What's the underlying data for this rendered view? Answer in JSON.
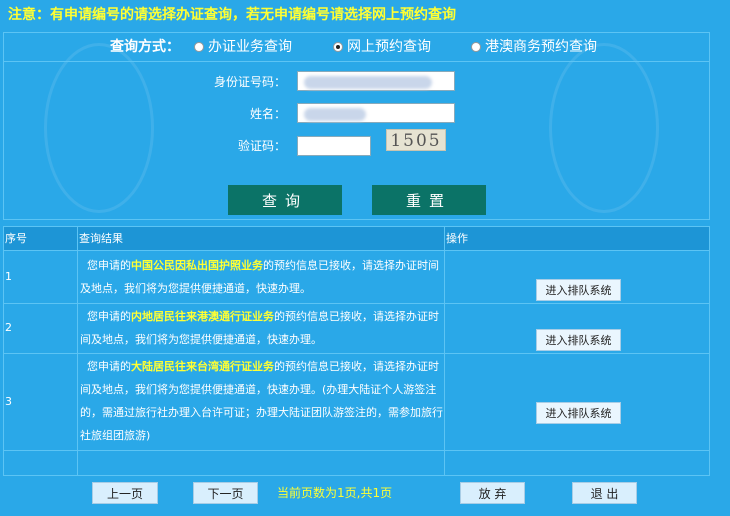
{
  "notice": "注意：有申请编号的请选择办证查询，若无申请编号请选择网上预约查询",
  "query_mode": {
    "label": "查询方式：",
    "options": [
      {
        "label": "办证业务查询",
        "checked": false
      },
      {
        "label": "网上预约查询",
        "checked": true
      },
      {
        "label": "港澳商务预约查询",
        "checked": false
      }
    ]
  },
  "form": {
    "id_label": "身份证号码：",
    "name_label": "姓名：",
    "captcha_label": "验证码：",
    "captcha_text": "1505"
  },
  "buttons": {
    "query": "查询",
    "reset": "重置"
  },
  "results": {
    "headers": {
      "seq": "序号",
      "result": "查询结果",
      "action": "操作"
    },
    "rows": [
      {
        "seq": "1",
        "pre": "您申请的",
        "business": "中国公民因私出国护照业务",
        "post": "的预约信息已接收，请选择办证时间及地点，我们将为您提供便捷通道，快速办理。",
        "action": "进入排队系统"
      },
      {
        "seq": "2",
        "pre": "您申请的",
        "business": "内地居民往来港澳通行证业务",
        "post": "的预约信息已接收，请选择办证时间及地点，我们将为您提供便捷通道，快速办理。",
        "action": "进入排队系统"
      },
      {
        "seq": "3",
        "pre": "您申请的",
        "business": "大陆居民往来台湾通行证业务",
        "post": "的预约信息已接收，请选择办证时间及地点，我们将为您提供便捷通道，快速办理。(办理大陆证个人游签注的，需通过旅行社办理入台许可证；办理大陆证团队游签注的，需参加旅行社旅组团旅游)",
        "action": "进入排队系统"
      }
    ]
  },
  "footer": {
    "prev": "上一页",
    "next": "下一页",
    "page_info": "当前页数为1页,共1页",
    "abandon": "放 弃",
    "exit": "退 出"
  },
  "colors": {
    "background": "#2aa8e8",
    "highlight": "#ffff33",
    "button_dark": "#0b7367"
  }
}
